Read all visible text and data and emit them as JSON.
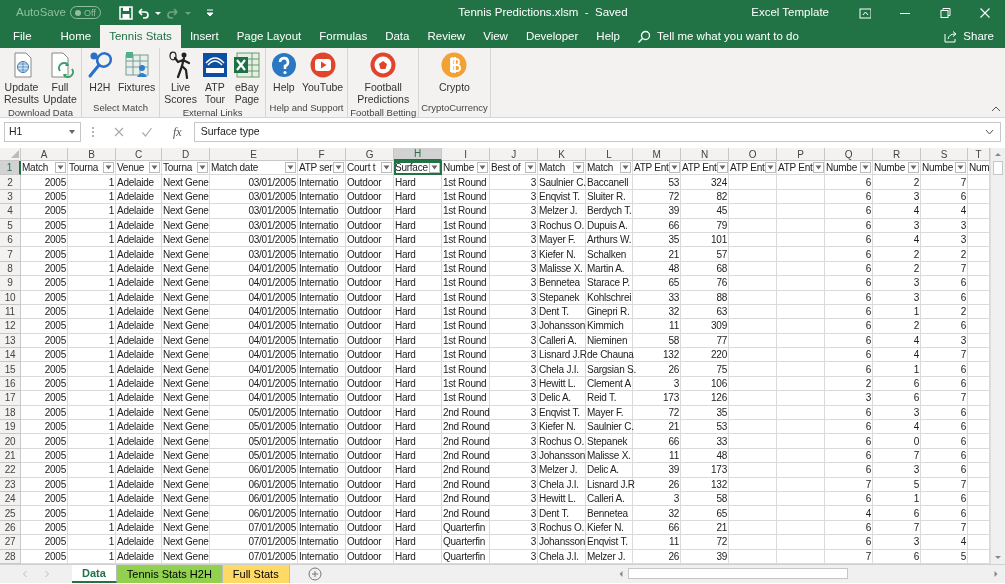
{
  "title_bar": {
    "autosave_label": "AutoSave",
    "autosave_on": false,
    "autosave_state": "Off",
    "title": "Tennis Predictions.xlsm  -  Saved",
    "account": "Excel Template"
  },
  "ribbon_tabs": [
    {
      "label": "File",
      "selected": false
    },
    {
      "label": "Home",
      "selected": false
    },
    {
      "label": "Tennis Stats",
      "selected": true
    },
    {
      "label": "Insert",
      "selected": false
    },
    {
      "label": "Page Layout",
      "selected": false
    },
    {
      "label": "Formulas",
      "selected": false
    },
    {
      "label": "Data",
      "selected": false
    },
    {
      "label": "Review",
      "selected": false
    },
    {
      "label": "View",
      "selected": false
    },
    {
      "label": "Developer",
      "selected": false
    },
    {
      "label": "Help",
      "selected": false
    }
  ],
  "tell_me": {
    "placeholder": "Tell me what you want to do"
  },
  "share": "Share",
  "ribbon_groups": [
    {
      "label": "Download Data",
      "buttons": [
        {
          "lines": [
            "Update",
            "Results"
          ],
          "kind": "doc-globe"
        },
        {
          "lines": [
            "Full",
            "Update"
          ],
          "kind": "doc-refresh"
        }
      ]
    },
    {
      "label": "Select Match",
      "buttons": [
        {
          "lines": [
            "H2H"
          ],
          "kind": "racket"
        },
        {
          "lines": [
            "Fixtures"
          ],
          "kind": "calendar"
        }
      ]
    },
    {
      "label": "External Links",
      "buttons": [
        {
          "lines": [
            "Live",
            "Scores"
          ],
          "kind": "player"
        },
        {
          "lines": [
            "ATP",
            "Tour"
          ],
          "kind": "tile"
        },
        {
          "lines": [
            "eBay",
            "Page"
          ],
          "kind": "sheet"
        }
      ]
    },
    {
      "label": "Help and Support",
      "buttons": [
        {
          "lines": [
            "Help"
          ],
          "kind": "help"
        },
        {
          "lines": [
            "YouTube"
          ],
          "kind": "video"
        }
      ]
    },
    {
      "label": "Football Betting",
      "buttons": [
        {
          "lines": [
            "Football",
            "Predictions"
          ],
          "kind": "ball"
        }
      ]
    },
    {
      "label": "CryptoCurrency",
      "buttons": [
        {
          "lines": [
            "Crypto"
          ],
          "kind": "coin"
        }
      ]
    }
  ],
  "formula_bar": {
    "name_box": "H1",
    "function_label": "fx",
    "value": "Surface type"
  },
  "sheet": {
    "header_row": {
      "number": "1",
      "selected": true
    },
    "columns": [
      {
        "letter": "A",
        "header": "Match",
        "kind": "number",
        "filter_button": true,
        "selected": false
      },
      {
        "letter": "B",
        "header": "Tourna",
        "kind": "number",
        "filter_button": true,
        "selected": false
      },
      {
        "letter": "C",
        "header": "Venue",
        "kind": "text",
        "filter_button": true,
        "selected": false
      },
      {
        "letter": "D",
        "header": "Tourna",
        "kind": "text",
        "filter_button": true,
        "selected": false
      },
      {
        "letter": "E",
        "header": "Match date",
        "kind": "number",
        "filter_button": true,
        "selected": false
      },
      {
        "letter": "F",
        "header": "ATP ser",
        "kind": "text",
        "filter_button": true,
        "selected": false
      },
      {
        "letter": "G",
        "header": "Court t",
        "kind": "text",
        "filter_button": true,
        "selected": false
      },
      {
        "letter": "H",
        "header": "Surface",
        "kind": "text",
        "filter_button": true,
        "selected": true
      },
      {
        "letter": "I",
        "header": "Numbe",
        "kind": "text",
        "filter_button": true,
        "selected": false
      },
      {
        "letter": "J",
        "header": "Best of",
        "kind": "number",
        "filter_button": true,
        "selected": false
      },
      {
        "letter": "K",
        "header": "Match",
        "kind": "text",
        "filter_button": true,
        "selected": false
      },
      {
        "letter": "L",
        "header": "Match",
        "kind": "text",
        "filter_button": true,
        "selected": false
      },
      {
        "letter": "M",
        "header": "ATP Ent",
        "kind": "number",
        "filter_button": true,
        "selected": false
      },
      {
        "letter": "N",
        "header": "ATP Ent",
        "kind": "number",
        "filter_button": true,
        "selected": false
      },
      {
        "letter": "O",
        "header": "ATP Ent",
        "filter_button": true,
        "selected": false
      },
      {
        "letter": "P",
        "header": "ATP Ent",
        "filter_button": true,
        "selected": false
      },
      {
        "letter": "Q",
        "header": "Numbe",
        "kind": "number",
        "filter_button": true,
        "selected": false
      },
      {
        "letter": "R",
        "header": "Numbe",
        "kind": "number",
        "filter_button": true,
        "selected": false
      },
      {
        "letter": "S",
        "header": "Numbe",
        "kind": "number",
        "filter_button": true,
        "selected": false
      },
      {
        "letter": "T",
        "header": "Num",
        "filter_button": false,
        "selected": false
      }
    ],
    "rows": [
      {
        "number": "2",
        "cells": [
          "2005",
          "1",
          "Adelaide",
          "Next Gene",
          "03/01/2005",
          "Internatio",
          "Outdoor",
          "Hard",
          "1st Round",
          "3",
          "Saulnier C.",
          "Baccanell",
          "53",
          "324",
          null,
          null,
          "6",
          "2",
          "7",
          null
        ]
      },
      {
        "number": "3",
        "cells": [
          "2005",
          "1",
          "Adelaide",
          "Next Gene",
          "03/01/2005",
          "Internatio",
          "Outdoor",
          "Hard",
          "1st Round",
          "3",
          "Enqvist T.",
          "Sluiter R.",
          "72",
          "82",
          null,
          null,
          "6",
          "3",
          "6",
          null
        ]
      },
      {
        "number": "4",
        "cells": [
          "2005",
          "1",
          "Adelaide",
          "Next Gene",
          "03/01/2005",
          "Internatio",
          "Outdoor",
          "Hard",
          "1st Round",
          "3",
          "Melzer J.",
          "Berdych T.",
          "39",
          "45",
          null,
          null,
          "6",
          "4",
          "4",
          null
        ]
      },
      {
        "number": "5",
        "cells": [
          "2005",
          "1",
          "Adelaide",
          "Next Gene",
          "03/01/2005",
          "Internatio",
          "Outdoor",
          "Hard",
          "1st Round",
          "3",
          "Rochus O.",
          "Dupuis A.",
          "66",
          "79",
          null,
          null,
          "6",
          "3",
          "3",
          null
        ]
      },
      {
        "number": "6",
        "cells": [
          "2005",
          "1",
          "Adelaide",
          "Next Gene",
          "03/01/2005",
          "Internatio",
          "Outdoor",
          "Hard",
          "1st Round",
          "3",
          "Mayer F.",
          "Arthurs W.",
          "35",
          "101",
          null,
          null,
          "6",
          "4",
          "3",
          null
        ]
      },
      {
        "number": "7",
        "cells": [
          "2005",
          "1",
          "Adelaide",
          "Next Gene",
          "03/01/2005",
          "Internatio",
          "Outdoor",
          "Hard",
          "1st Round",
          "3",
          "Kiefer N.",
          "Schalken",
          "21",
          "57",
          null,
          null,
          "6",
          "2",
          "2",
          null
        ]
      },
      {
        "number": "8",
        "cells": [
          "2005",
          "1",
          "Adelaide",
          "Next Gene",
          "04/01/2005",
          "Internatio",
          "Outdoor",
          "Hard",
          "1st Round",
          "3",
          "Malisse X.",
          "Martin A.",
          "48",
          "68",
          null,
          null,
          "6",
          "2",
          "7",
          null
        ]
      },
      {
        "number": "9",
        "cells": [
          "2005",
          "1",
          "Adelaide",
          "Next Gene",
          "04/01/2005",
          "Internatio",
          "Outdoor",
          "Hard",
          "1st Round",
          "3",
          "Bennetea",
          "Starace P.",
          "65",
          "76",
          null,
          null,
          "6",
          "3",
          "6",
          null
        ]
      },
      {
        "number": "10",
        "cells": [
          "2005",
          "1",
          "Adelaide",
          "Next Gene",
          "04/01/2005",
          "Internatio",
          "Outdoor",
          "Hard",
          "1st Round",
          "3",
          "Stepanek",
          "Kohlschrei",
          "33",
          "88",
          null,
          null,
          "6",
          "3",
          "6",
          null
        ]
      },
      {
        "number": "11",
        "cells": [
          "2005",
          "1",
          "Adelaide",
          "Next Gene",
          "04/01/2005",
          "Internatio",
          "Outdoor",
          "Hard",
          "1st Round",
          "3",
          "Dent T.",
          "Ginepri R.",
          "32",
          "63",
          null,
          null,
          "6",
          "1",
          "2",
          null
        ]
      },
      {
        "number": "12",
        "cells": [
          "2005",
          "1",
          "Adelaide",
          "Next Gene",
          "04/01/2005",
          "Internatio",
          "Outdoor",
          "Hard",
          "1st Round",
          "3",
          "Johansson",
          "Kimmich",
          "11",
          "309",
          null,
          null,
          "6",
          "2",
          "6",
          null
        ]
      },
      {
        "number": "13",
        "cells": [
          "2005",
          "1",
          "Adelaide",
          "Next Gene",
          "04/01/2005",
          "Internatio",
          "Outdoor",
          "Hard",
          "1st Round",
          "3",
          "Calleri A.",
          "Nieminen",
          "58",
          "77",
          null,
          null,
          "6",
          "4",
          "3",
          null
        ]
      },
      {
        "number": "14",
        "cells": [
          "2005",
          "1",
          "Adelaide",
          "Next Gene",
          "04/01/2005",
          "Internatio",
          "Outdoor",
          "Hard",
          "1st Round",
          "3",
          "Lisnard J.R",
          "de Chauna",
          "132",
          "220",
          null,
          null,
          "6",
          "4",
          "7",
          null
        ]
      },
      {
        "number": "15",
        "cells": [
          "2005",
          "1",
          "Adelaide",
          "Next Gene",
          "04/01/2005",
          "Internatio",
          "Outdoor",
          "Hard",
          "1st Round",
          "3",
          "Chela J.I.",
          "Sargsian S.",
          "26",
          "75",
          null,
          null,
          "6",
          "1",
          "6",
          null
        ]
      },
      {
        "number": "16",
        "cells": [
          "2005",
          "1",
          "Adelaide",
          "Next Gene",
          "04/01/2005",
          "Internatio",
          "Outdoor",
          "Hard",
          "1st Round",
          "3",
          "Hewitt L.",
          "Clement A",
          "3",
          "106",
          null,
          null,
          "2",
          "6",
          "6",
          null
        ]
      },
      {
        "number": "17",
        "cells": [
          "2005",
          "1",
          "Adelaide",
          "Next Gene",
          "04/01/2005",
          "Internatio",
          "Outdoor",
          "Hard",
          "1st Round",
          "3",
          "Delic A.",
          "Reid T.",
          "173",
          "126",
          null,
          null,
          "3",
          "6",
          "7",
          null
        ]
      },
      {
        "number": "18",
        "cells": [
          "2005",
          "1",
          "Adelaide",
          "Next Gene",
          "05/01/2005",
          "Internatio",
          "Outdoor",
          "Hard",
          "2nd Round",
          "3",
          "Enqvist T.",
          "Mayer F.",
          "72",
          "35",
          null,
          null,
          "6",
          "3",
          "6",
          null
        ]
      },
      {
        "number": "19",
        "cells": [
          "2005",
          "1",
          "Adelaide",
          "Next Gene",
          "05/01/2005",
          "Internatio",
          "Outdoor",
          "Hard",
          "2nd Round",
          "3",
          "Kiefer N.",
          "Saulnier C.",
          "21",
          "53",
          null,
          null,
          "6",
          "4",
          "6",
          null
        ]
      },
      {
        "number": "20",
        "cells": [
          "2005",
          "1",
          "Adelaide",
          "Next Gene",
          "05/01/2005",
          "Internatio",
          "Outdoor",
          "Hard",
          "2nd Round",
          "3",
          "Rochus O.",
          "Stepanek",
          "66",
          "33",
          null,
          null,
          "6",
          "0",
          "6",
          null
        ]
      },
      {
        "number": "21",
        "cells": [
          "2005",
          "1",
          "Adelaide",
          "Next Gene",
          "05/01/2005",
          "Internatio",
          "Outdoor",
          "Hard",
          "2nd Round",
          "3",
          "Johansson",
          "Malisse X.",
          "11",
          "48",
          null,
          null,
          "6",
          "7",
          "6",
          null
        ]
      },
      {
        "number": "22",
        "cells": [
          "2005",
          "1",
          "Adelaide",
          "Next Gene",
          "06/01/2005",
          "Internatio",
          "Outdoor",
          "Hard",
          "2nd Round",
          "3",
          "Melzer J.",
          "Delic A.",
          "39",
          "173",
          null,
          null,
          "6",
          "3",
          "6",
          null
        ]
      },
      {
        "number": "23",
        "cells": [
          "2005",
          "1",
          "Adelaide",
          "Next Gene",
          "06/01/2005",
          "Internatio",
          "Outdoor",
          "Hard",
          "2nd Round",
          "3",
          "Chela J.I.",
          "Lisnard J.R",
          "26",
          "132",
          null,
          null,
          "7",
          "5",
          "7",
          null
        ]
      },
      {
        "number": "24",
        "cells": [
          "2005",
          "1",
          "Adelaide",
          "Next Gene",
          "06/01/2005",
          "Internatio",
          "Outdoor",
          "Hard",
          "2nd Round",
          "3",
          "Hewitt L.",
          "Calleri A.",
          "3",
          "58",
          null,
          null,
          "6",
          "1",
          "6",
          null
        ]
      },
      {
        "number": "25",
        "cells": [
          "2005",
          "1",
          "Adelaide",
          "Next Gene",
          "06/01/2005",
          "Internatio",
          "Outdoor",
          "Hard",
          "2nd Round",
          "3",
          "Dent T.",
          "Bennetea",
          "32",
          "65",
          null,
          null,
          "4",
          "6",
          "6",
          null
        ]
      },
      {
        "number": "26",
        "cells": [
          "2005",
          "1",
          "Adelaide",
          "Next Gene",
          "07/01/2005",
          "Internatio",
          "Outdoor",
          "Hard",
          "Quarterfin",
          "3",
          "Rochus O.",
          "Kiefer N.",
          "66",
          "21",
          null,
          null,
          "6",
          "7",
          "7",
          null
        ]
      },
      {
        "number": "27",
        "cells": [
          "2005",
          "1",
          "Adelaide",
          "Next Gene",
          "07/01/2005",
          "Internatio",
          "Outdoor",
          "Hard",
          "Quarterfin",
          "3",
          "Johansson",
          "Enqvist T.",
          "11",
          "72",
          null,
          null,
          "6",
          "3",
          "4",
          null
        ]
      },
      {
        "number": "28",
        "cells": [
          "2005",
          "1",
          "Adelaide",
          "Next Gene",
          "07/01/2005",
          "Internatio",
          "Outdoor",
          "Hard",
          "Quarterfin",
          "3",
          "Chela J.I.",
          "Melzer J.",
          "26",
          "39",
          null,
          null,
          "7",
          "6",
          "5",
          null
        ]
      }
    ]
  },
  "sheet_tabs": [
    {
      "label": "Data",
      "selected": true
    },
    {
      "label": "Tennis Stats H2H",
      "selected": false,
      "color": "#92d050"
    },
    {
      "label": "Full Stats",
      "selected": false,
      "color": "#ffd966"
    }
  ]
}
